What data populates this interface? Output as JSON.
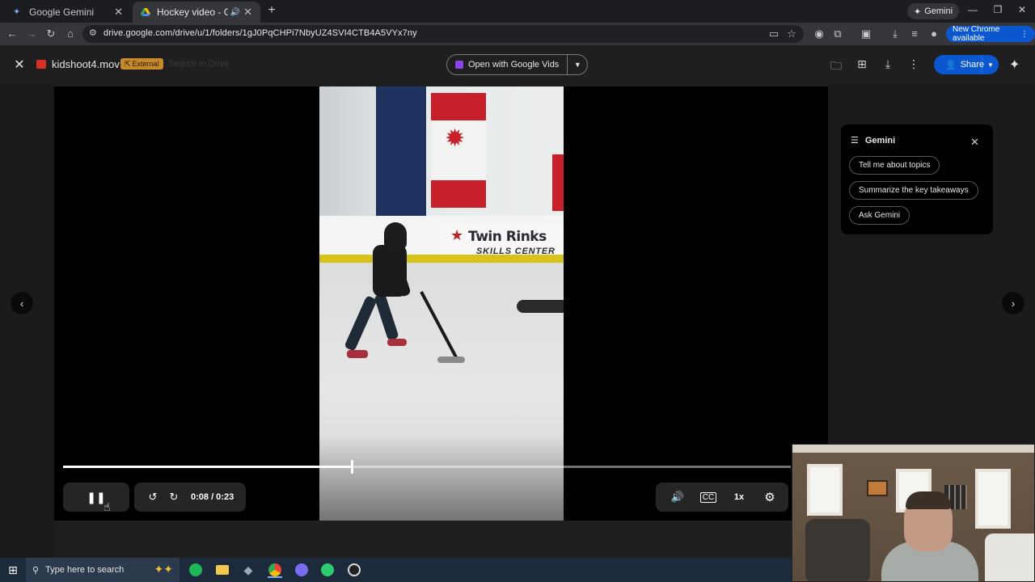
{
  "browser": {
    "tabs": [
      {
        "title": "Google Gemini",
        "active": false
      },
      {
        "title": "Hockey video - Google Drive",
        "active": true
      }
    ],
    "gemini_chip": "Gemini",
    "url": "drive.google.com/drive/u/1/folders/1gJ0PqCHPi7NbyUZ4SVI4CTB4A5VYx7ny",
    "update_chip": "New Chrome available"
  },
  "drive": {
    "file_name": "kidshoot4.mov",
    "badge": "External",
    "search_placeholder": "Search in Drive",
    "open_with": "Open with Google Vids",
    "share_label": "Share"
  },
  "video": {
    "current_time": "0:08",
    "duration": "0:23",
    "time_display": "0:08 / 0:23",
    "progress_fraction": 0.397,
    "speed": "1x",
    "sign_line1": "Twin Rinks",
    "sign_line2": "SKILLS CENTER"
  },
  "gemini_panel": {
    "title": "Gemini",
    "suggestions": [
      "Tell me about topics",
      "Summarize the key takeaways",
      "Ask Gemini"
    ]
  },
  "taskbar": {
    "search_placeholder": "Type here to search"
  },
  "colors": {
    "accent_blue": "#0b57d0",
    "external_badge": "#c48a2b",
    "page_bg": "#1f1f1f"
  }
}
